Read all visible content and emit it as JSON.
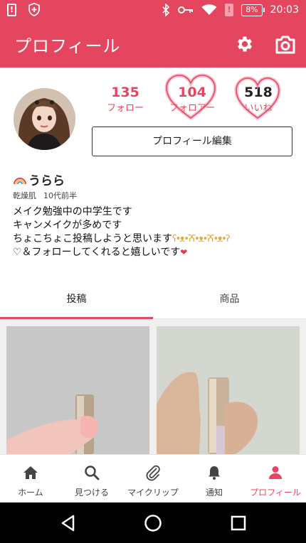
{
  "status_bar": {
    "battery": "8%",
    "time": "20:03"
  },
  "app_bar": {
    "title": "プロフィール",
    "settings_icon": "gear-icon",
    "camera_icon": "camera-icon"
  },
  "profile": {
    "stats": {
      "following_count": "135",
      "following_label": "フォロー",
      "followers_count": "104",
      "followers_label": "フォロアー",
      "likes_count": "518",
      "likes_label": "いいね"
    },
    "edit_button": "プロフィール編集",
    "name": "うらら",
    "skin_type": "乾燥肌",
    "age": "10代前半",
    "bio": [
      "メイク勉強中の中学生です",
      "キャンメイクが多めです",
      "ちょこちょこ投稿しようと思います",
      "♡＆フォローしてくれると嬉しいです"
    ]
  },
  "tabs": [
    {
      "label": "投稿"
    },
    {
      "label": "商品"
    }
  ],
  "bottom_nav": [
    {
      "label": "ホーム",
      "icon": "home-icon"
    },
    {
      "label": "見つける",
      "icon": "search-icon"
    },
    {
      "label": "マイクリップ",
      "icon": "paperclip-icon"
    },
    {
      "label": "通知",
      "icon": "bell-icon"
    },
    {
      "label": "プロフィール",
      "icon": "person-icon"
    }
  ],
  "colors": {
    "brand": "#e5465f",
    "brand_light": "#f3a0ac"
  }
}
